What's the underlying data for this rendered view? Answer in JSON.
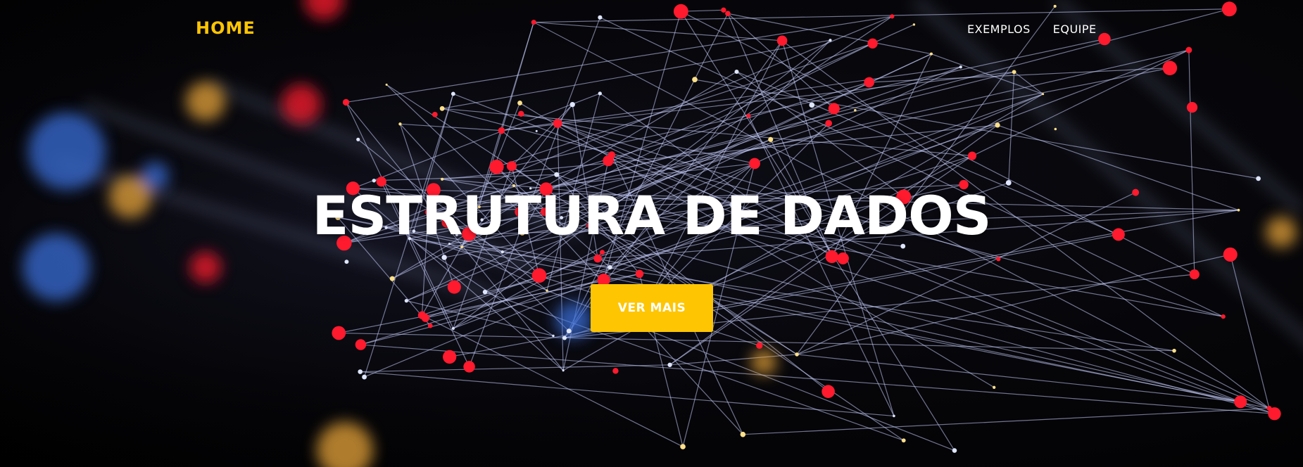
{
  "nav": {
    "brand": "HOME",
    "items": [
      {
        "label": "EXEMPLOS"
      },
      {
        "label": "EQUIPE"
      }
    ]
  },
  "hero": {
    "title": "ESTRUTURA DE DADOS",
    "cta_label": "VER MAIS"
  },
  "colors": {
    "accent": "#fec503",
    "background": "#000000",
    "text": "#ffffff",
    "node_red": "#ff1a2e",
    "node_blue": "#3a6fd8",
    "node_gold": "#e8a63a",
    "line": "#c8d0ff"
  }
}
